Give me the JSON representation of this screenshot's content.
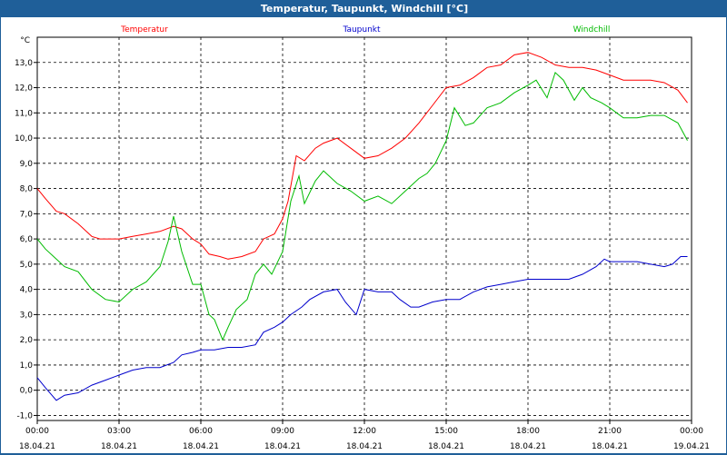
{
  "window": {
    "title": "Temperatur, Taupunkt, Windchill [°C]"
  },
  "colors": {
    "titlebar_bg": "#1f5f99",
    "temperatur": "#ff0000",
    "taupunkt": "#0000cc",
    "windchill": "#00bb00",
    "grid": "#000000"
  },
  "chart_data": {
    "type": "line",
    "title": "Temperatur, Taupunkt, Windchill [°C]",
    "ylabel": "°C",
    "ylim": [
      -1.2,
      14.0
    ],
    "yticks": [
      -1.0,
      0.0,
      1.0,
      2.0,
      3.0,
      4.0,
      5.0,
      6.0,
      7.0,
      8.0,
      9.0,
      10.0,
      11.0,
      12.0,
      13.0
    ],
    "ytick_labels": [
      "-1,0",
      "0,0",
      "1,0",
      "2,0",
      "3,0",
      "4,0",
      "5,0",
      "6,0",
      "7,0",
      "8,0",
      "9,0",
      "10,0",
      "11,0",
      "12,0",
      "13,0"
    ],
    "xlim": [
      0,
      24
    ],
    "xticks": [
      0,
      3,
      6,
      9,
      12,
      15,
      18,
      21,
      24
    ],
    "xtick_times": [
      "00:00",
      "03:00",
      "06:00",
      "09:00",
      "12:00",
      "15:00",
      "18:00",
      "21:00",
      "00:00"
    ],
    "xtick_dates": [
      "18.04.21",
      "18.04.21",
      "18.04.21",
      "18.04.21",
      "18.04.21",
      "18.04.21",
      "18.04.21",
      "18.04.21",
      "19.04.21"
    ],
    "grid": true,
    "legend_placement": "top",
    "series": [
      {
        "name": "Temperatur",
        "color": "#ff0000",
        "x": [
          0.0,
          0.3,
          0.7,
          1.0,
          1.5,
          2.0,
          2.3,
          2.7,
          3.0,
          3.5,
          4.0,
          4.5,
          5.0,
          5.3,
          5.7,
          6.0,
          6.3,
          6.7,
          7.0,
          7.5,
          8.0,
          8.3,
          8.7,
          9.0,
          9.2,
          9.5,
          9.8,
          10.2,
          10.5,
          11.0,
          11.5,
          12.0,
          12.5,
          13.0,
          13.5,
          14.0,
          14.5,
          15.0,
          15.5,
          16.0,
          16.5,
          17.0,
          17.5,
          18.0,
          18.5,
          19.0,
          19.5,
          20.0,
          20.5,
          21.0,
          21.5,
          22.0,
          22.5,
          23.0,
          23.5,
          23.85
        ],
        "values": [
          8.0,
          7.6,
          7.1,
          7.0,
          6.6,
          6.1,
          6.0,
          6.0,
          6.0,
          6.1,
          6.2,
          6.3,
          6.5,
          6.4,
          6.0,
          5.8,
          5.4,
          5.3,
          5.2,
          5.3,
          5.5,
          6.0,
          6.2,
          6.8,
          7.5,
          9.3,
          9.1,
          9.6,
          9.8,
          10.0,
          9.6,
          9.2,
          9.3,
          9.6,
          10.0,
          10.6,
          11.3,
          12.0,
          12.1,
          12.4,
          12.8,
          12.9,
          13.3,
          13.4,
          13.2,
          12.9,
          12.8,
          12.8,
          12.7,
          12.5,
          12.3,
          12.3,
          12.3,
          12.2,
          11.9,
          11.4
        ]
      },
      {
        "name": "Taupunkt",
        "color": "#0000cc",
        "x": [
          0.0,
          0.3,
          0.7,
          1.0,
          1.5,
          2.0,
          2.5,
          3.0,
          3.5,
          4.0,
          4.5,
          5.0,
          5.3,
          5.7,
          6.0,
          6.5,
          7.0,
          7.5,
          8.0,
          8.3,
          8.7,
          9.0,
          9.3,
          9.7,
          10.0,
          10.5,
          11.0,
          11.3,
          11.7,
          12.0,
          12.5,
          13.0,
          13.3,
          13.7,
          14.0,
          14.5,
          15.0,
          15.5,
          16.0,
          16.5,
          17.0,
          17.5,
          18.0,
          18.5,
          19.0,
          19.5,
          20.0,
          20.5,
          20.8,
          21.0,
          21.5,
          22.0,
          22.5,
          23.0,
          23.3,
          23.6,
          23.85
        ],
        "values": [
          0.5,
          0.1,
          -0.4,
          -0.2,
          -0.1,
          0.2,
          0.4,
          0.6,
          0.8,
          0.9,
          0.9,
          1.1,
          1.4,
          1.5,
          1.6,
          1.6,
          1.7,
          1.7,
          1.8,
          2.3,
          2.5,
          2.7,
          3.0,
          3.3,
          3.6,
          3.9,
          4.0,
          3.5,
          3.0,
          4.0,
          3.9,
          3.9,
          3.6,
          3.3,
          3.3,
          3.5,
          3.6,
          3.6,
          3.9,
          4.1,
          4.2,
          4.3,
          4.4,
          4.4,
          4.4,
          4.4,
          4.6,
          4.9,
          5.2,
          5.1,
          5.1,
          5.1,
          5.0,
          4.9,
          5.0,
          5.3,
          5.3
        ]
      },
      {
        "name": "Windchill",
        "color": "#00bb00",
        "x": [
          0.0,
          0.3,
          0.7,
          1.0,
          1.5,
          2.0,
          2.5,
          3.0,
          3.5,
          4.0,
          4.5,
          4.8,
          5.0,
          5.3,
          5.7,
          6.0,
          6.3,
          6.5,
          6.8,
          7.0,
          7.3,
          7.7,
          8.0,
          8.3,
          8.6,
          9.0,
          9.3,
          9.6,
          9.8,
          10.2,
          10.5,
          11.0,
          11.5,
          12.0,
          12.5,
          13.0,
          13.5,
          14.0,
          14.3,
          14.6,
          15.0,
          15.3,
          15.7,
          16.0,
          16.5,
          17.0,
          17.5,
          18.0,
          18.3,
          18.7,
          19.0,
          19.3,
          19.7,
          20.0,
          20.3,
          20.7,
          21.0,
          21.5,
          22.0,
          22.5,
          23.0,
          23.5,
          23.85
        ],
        "values": [
          6.0,
          5.6,
          5.2,
          4.9,
          4.7,
          4.0,
          3.6,
          3.5,
          4.0,
          4.3,
          4.9,
          5.9,
          6.9,
          5.5,
          4.2,
          4.2,
          3.0,
          2.8,
          2.0,
          2.5,
          3.2,
          3.6,
          4.6,
          5.0,
          4.6,
          5.5,
          7.5,
          8.5,
          7.4,
          8.3,
          8.7,
          8.2,
          7.9,
          7.5,
          7.7,
          7.4,
          7.9,
          8.4,
          8.6,
          9.0,
          9.9,
          11.2,
          10.5,
          10.6,
          11.2,
          11.4,
          11.8,
          12.1,
          12.3,
          11.6,
          12.6,
          12.3,
          11.5,
          12.0,
          11.6,
          11.4,
          11.2,
          10.8,
          10.8,
          10.9,
          10.9,
          10.6,
          9.9
        ]
      }
    ]
  }
}
